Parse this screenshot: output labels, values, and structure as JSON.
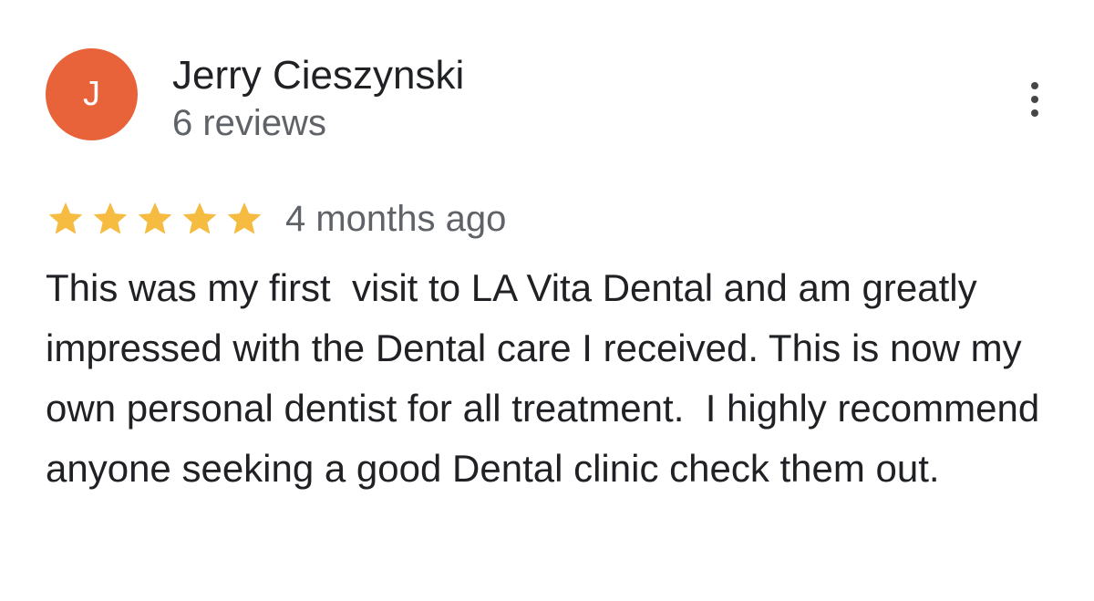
{
  "review": {
    "author": {
      "initial": "J",
      "avatar_color": "#E8623A",
      "name": "Jerry Cieszynski",
      "review_count": "6 reviews"
    },
    "more_options_icon": "more-vert-icon",
    "rating": {
      "stars": 5,
      "max_stars": 5,
      "star_color": "#F6BC42",
      "star_icon": "star-icon"
    },
    "time_ago": "4 months ago",
    "text": "This was my first  visit to LA Vita Dental and am greatly impressed with the Dental care I received. This is now my own personal dentist for all treatment.  I highly recommend anyone seeking a good Dental clinic check them out."
  }
}
